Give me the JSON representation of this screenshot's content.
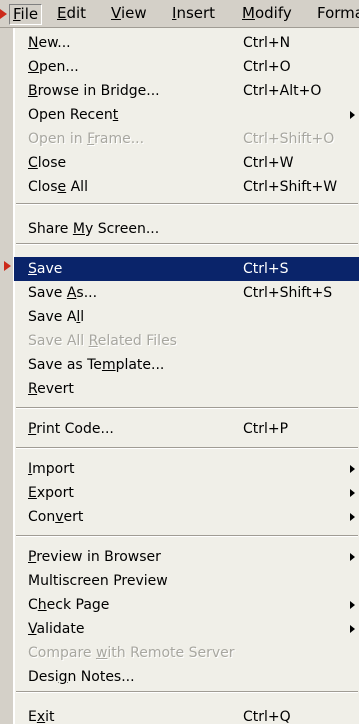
{
  "menubar": {
    "items": [
      {
        "label": "File",
        "mnemonic": "F",
        "rest": "ile"
      },
      {
        "label": "Edit",
        "mnemonic": "E",
        "rest": "dit"
      },
      {
        "label": "View",
        "mnemonic": "V",
        "rest": "iew"
      },
      {
        "label": "Insert",
        "mnemonic": "I",
        "rest": "nsert"
      },
      {
        "label": "Modify",
        "mnemonic": "M",
        "rest": "odify"
      },
      {
        "label": "Forma",
        "mnemonic": "",
        "rest": "Forma"
      }
    ],
    "open_menu": "File"
  },
  "file_menu": {
    "items": [
      {
        "pre": "",
        "u": "N",
        "post": "ew...",
        "shortcut": "Ctrl+N",
        "submenu": false,
        "disabled": false,
        "selected": false
      },
      {
        "pre": "",
        "u": "O",
        "post": "pen...",
        "shortcut": "Ctrl+O",
        "submenu": false,
        "disabled": false,
        "selected": false
      },
      {
        "pre": "",
        "u": "B",
        "post": "rowse in Bridge...",
        "shortcut": "Ctrl+Alt+O",
        "submenu": false,
        "disabled": false,
        "selected": false
      },
      {
        "pre": "Open Recen",
        "u": "t",
        "post": "",
        "shortcut": "",
        "submenu": true,
        "disabled": false,
        "selected": false
      },
      {
        "pre": "Open in ",
        "u": "F",
        "post": "rame...",
        "shortcut": "Ctrl+Shift+O",
        "submenu": false,
        "disabled": true,
        "selected": false
      },
      {
        "pre": "",
        "u": "C",
        "post": "lose",
        "shortcut": "Ctrl+W",
        "submenu": false,
        "disabled": false,
        "selected": false
      },
      {
        "pre": "Clos",
        "u": "e",
        "post": " All",
        "shortcut": "Ctrl+Shift+W",
        "submenu": false,
        "disabled": false,
        "selected": false
      },
      {
        "pre": "Share ",
        "u": "M",
        "post": "y Screen...",
        "shortcut": "",
        "submenu": false,
        "disabled": false,
        "selected": false
      },
      {
        "pre": "",
        "u": "S",
        "post": "ave",
        "shortcut": "Ctrl+S",
        "submenu": false,
        "disabled": false,
        "selected": true
      },
      {
        "pre": "Save ",
        "u": "A",
        "post": "s...",
        "shortcut": "Ctrl+Shift+S",
        "submenu": false,
        "disabled": false,
        "selected": false
      },
      {
        "pre": "Save A",
        "u": "l",
        "post": "l",
        "shortcut": "",
        "submenu": false,
        "disabled": false,
        "selected": false
      },
      {
        "pre": "Save All ",
        "u": "R",
        "post": "elated Files",
        "shortcut": "",
        "submenu": false,
        "disabled": true,
        "selected": false
      },
      {
        "pre": "Save as Te",
        "u": "m",
        "post": "plate...",
        "shortcut": "",
        "submenu": false,
        "disabled": false,
        "selected": false
      },
      {
        "pre": "",
        "u": "R",
        "post": "evert",
        "shortcut": "",
        "submenu": false,
        "disabled": false,
        "selected": false
      },
      {
        "pre": "",
        "u": "P",
        "post": "rint Code...",
        "shortcut": "Ctrl+P",
        "submenu": false,
        "disabled": false,
        "selected": false
      },
      {
        "pre": "",
        "u": "I",
        "post": "mport",
        "shortcut": "",
        "submenu": true,
        "disabled": false,
        "selected": false
      },
      {
        "pre": "",
        "u": "E",
        "post": "xport",
        "shortcut": "",
        "submenu": true,
        "disabled": false,
        "selected": false
      },
      {
        "pre": "Con",
        "u": "v",
        "post": "ert",
        "shortcut": "",
        "submenu": true,
        "disabled": false,
        "selected": false
      },
      {
        "pre": "",
        "u": "P",
        "post": "review in Browser",
        "shortcut": "",
        "submenu": true,
        "disabled": false,
        "selected": false
      },
      {
        "pre": "Multiscreen Preview",
        "u": "",
        "post": "",
        "shortcut": "",
        "submenu": false,
        "disabled": false,
        "selected": false
      },
      {
        "pre": "C",
        "u": "h",
        "post": "eck Page",
        "shortcut": "",
        "submenu": true,
        "disabled": false,
        "selected": false
      },
      {
        "pre": "",
        "u": "V",
        "post": "alidate",
        "shortcut": "",
        "submenu": true,
        "disabled": false,
        "selected": false
      },
      {
        "pre": "Compare ",
        "u": "w",
        "post": "ith Remote Server",
        "shortcut": "",
        "submenu": false,
        "disabled": true,
        "selected": false
      },
      {
        "pre": "Desi",
        "u": "g",
        "post": "n Notes...",
        "shortcut": "",
        "submenu": false,
        "disabled": false,
        "selected": false
      },
      {
        "pre": "E",
        "u": "x",
        "post": "it",
        "shortcut": "Ctrl+Q",
        "submenu": false,
        "disabled": false,
        "selected": false
      }
    ]
  },
  "colors": {
    "selection": "#0a246a",
    "menu_bg": "#f0efe8",
    "chrome_bg": "#d4d0c8",
    "disabled_text": "#a8a7a0",
    "pointer_arrow": "#cc2a1a"
  }
}
